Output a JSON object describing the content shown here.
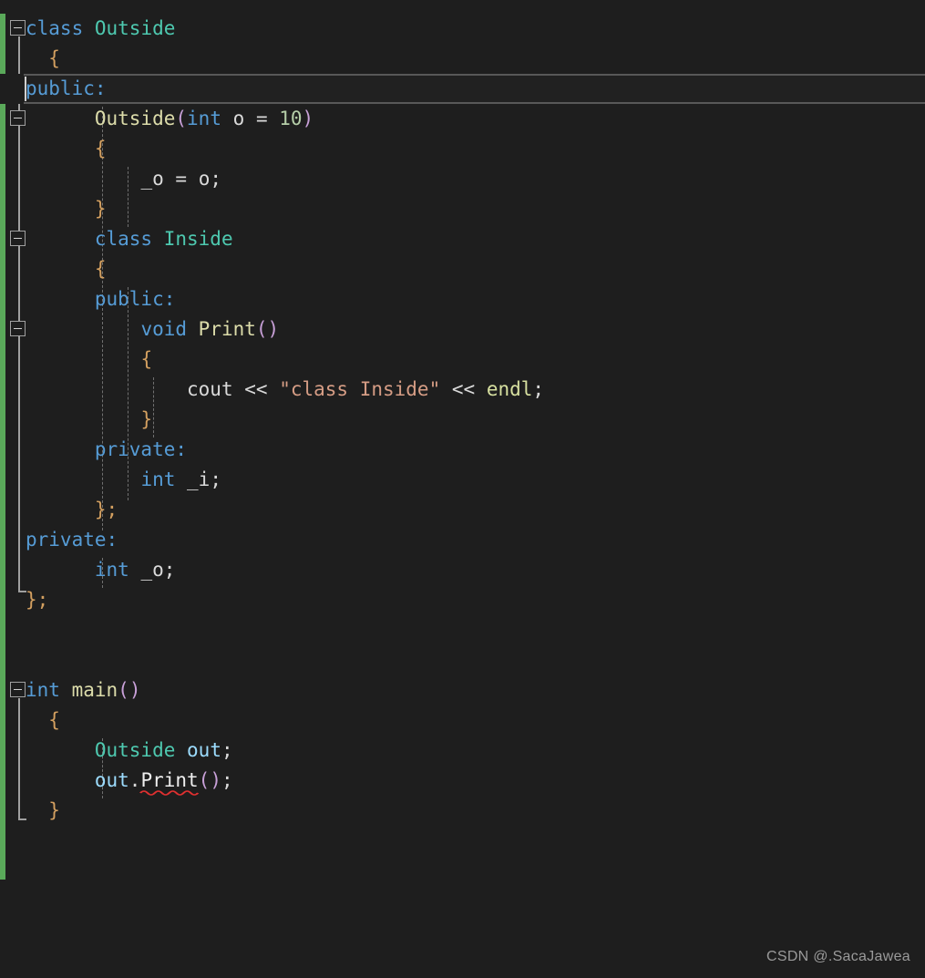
{
  "editor": {
    "language": "C++",
    "background_color": "#1e1e1e",
    "change_bar_color": "#5aa95a",
    "current_line": 3,
    "cursor_line_text": "public:",
    "font_size_px": 21,
    "line_height_px": 33
  },
  "colors": {
    "keyword": "#569cd6",
    "class_type": "#4ec9b0",
    "function": "#dcdcaa",
    "brace": "#d4a060",
    "paren": "#c8a0d8",
    "number": "#b5cea8",
    "string": "#d69d85",
    "variable": "#9cdcfe",
    "plain": "#dadada",
    "macro": "#d7e0a0",
    "error_squiggle": "#e03030",
    "gutter_line": "#a0a0a0",
    "indent_guide": "#707070"
  },
  "code": {
    "lines": [
      "class Outside",
      "{",
      "public:",
      "    Outside(int o = 10)",
      "    {",
      "        _o = o;",
      "    }",
      "    class Inside",
      "    {",
      "    public:",
      "        void Print()",
      "        {",
      "            cout << \"class Inside\" << endl;",
      "        }",
      "    private:",
      "        int _i;",
      "    };",
      "private:",
      "    int _o;",
      "};",
      "",
      "",
      "int main()",
      "{",
      "    Outside out;",
      "    out.Print();",
      "}"
    ]
  },
  "tokens": {
    "kw_class": "class",
    "kw_public": "public:",
    "kw_private": "private:",
    "kw_int": "int",
    "kw_void": "void",
    "type_outside": "Outside",
    "type_inside": "Inside",
    "fn_ctor": "Outside",
    "fn_print": "Print",
    "fn_main": "main",
    "var_o": "o",
    "var__o": "_o",
    "var__i": "_i",
    "var_out": "out",
    "num_10": "10",
    "str_class_inside": "\"class Inside\"",
    "id_cout": "cout",
    "id_endl": "endl",
    "op_shift": "<<",
    "op_assign": "=",
    "op_dot": ".",
    "semicolon": ";",
    "brace_open": "{",
    "brace_close": "}",
    "brace_close_semi": "};",
    "paren_open": "(",
    "paren_close": ")",
    "paren_empty": "()"
  },
  "diagnostics": [
    {
      "line": 25,
      "token": "Print",
      "kind": "error-squiggle",
      "color": "#e03030"
    }
  ],
  "folds": [
    {
      "line": 1,
      "label": "class Outside",
      "state": "expanded",
      "marker": "minus"
    },
    {
      "line": 4,
      "label": "Outside(int o = 10)",
      "state": "expanded",
      "marker": "minus"
    },
    {
      "line": 8,
      "label": "class Inside",
      "state": "expanded",
      "marker": "minus"
    },
    {
      "line": 11,
      "label": "void Print()",
      "state": "expanded",
      "marker": "minus"
    },
    {
      "line": 22,
      "label": "int main()",
      "state": "expanded",
      "marker": "minus"
    }
  ],
  "watermark": {
    "text": "CSDN @.SacaJawea"
  }
}
